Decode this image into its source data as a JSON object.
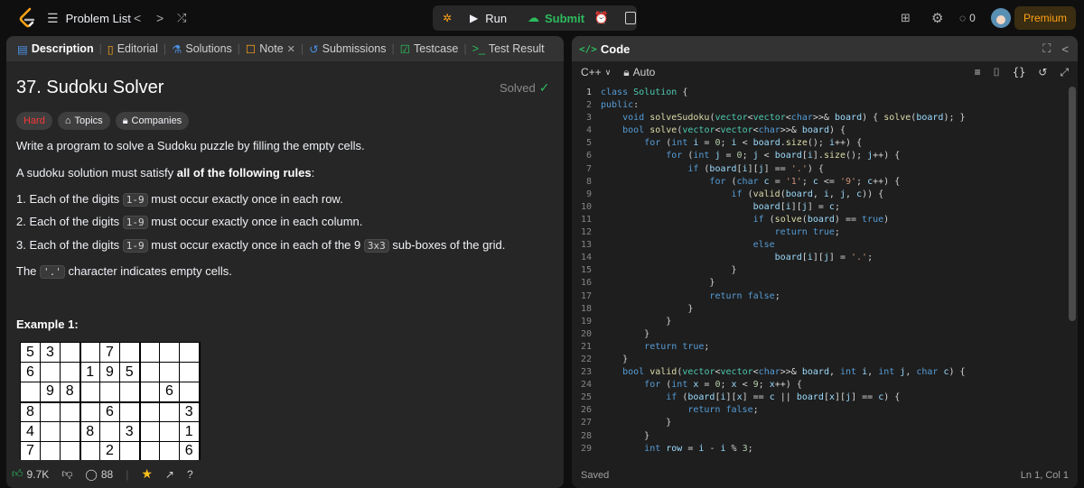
{
  "topbar": {
    "problem_list": "Problem List",
    "run": "Run",
    "submit": "Submit",
    "notif_count": "0",
    "premium": "Premium"
  },
  "tabs": {
    "description": "Description",
    "editorial": "Editorial",
    "solutions": "Solutions",
    "note": "Note",
    "submissions": "Submissions",
    "testcase": "Testcase",
    "test_result": "Test Result"
  },
  "problem": {
    "title": "37. Sudoku Solver",
    "status": "Solved",
    "difficulty": "Hard",
    "topics": "Topics",
    "companies": "Companies",
    "intro": "Write a program to solve a Sudoku puzzle by filling the empty cells.",
    "rules_lead": "A sudoku solution must satisfy ",
    "rules_bold": "all of the following rules",
    "rules_tail": ":",
    "rule1_a": "1. Each of the digits ",
    "rule1_code": "1-9",
    "rule1_b": " must occur exactly once in each row.",
    "rule2_a": "2. Each of the digits ",
    "rule2_code": "1-9",
    "rule2_b": " must occur exactly once in each column.",
    "rule3_a": "3. Each of the digits ",
    "rule3_code": "1-9",
    "rule3_b": " must occur exactly once in each of the 9 ",
    "rule3_code2": "3x3",
    "rule3_c": " sub-boxes of the grid.",
    "empty_a": "The ",
    "empty_code": "'.'",
    "empty_b": " character indicates empty cells.",
    "example_heading": "Example 1:"
  },
  "sudoku_rows": [
    [
      "5",
      "3",
      "",
      "",
      "7",
      "",
      "",
      "",
      ""
    ],
    [
      "6",
      "",
      "",
      "1",
      "9",
      "5",
      "",
      "",
      ""
    ],
    [
      "",
      "9",
      "8",
      "",
      "",
      "",
      "",
      "6",
      ""
    ],
    [
      "8",
      "",
      "",
      "",
      "6",
      "",
      "",
      "",
      "3"
    ],
    [
      "4",
      "",
      "",
      "8",
      "",
      "3",
      "",
      "",
      "1"
    ],
    [
      "7",
      "",
      "",
      "",
      "2",
      "",
      "",
      "",
      "6"
    ]
  ],
  "footer": {
    "likes": "9.7K",
    "comments": "88"
  },
  "editor": {
    "header": "Code",
    "language": "C++",
    "mode": "Auto",
    "status_left": "Saved",
    "status_right": "Ln 1, Col 1"
  },
  "code_lines": [
    "class Solution {",
    "public:",
    "    void solveSudoku(vector<vector<char>>& board) { solve(board); }",
    "    bool solve(vector<vector<char>>& board) {",
    "        for (int i = 0; i < board.size(); i++) {",
    "            for (int j = 0; j < board[i].size(); j++) {",
    "                if (board[i][j] == '.') {",
    "                    for (char c = '1'; c <= '9'; c++) {",
    "                        if (valid(board, i, j, c)) {",
    "                            board[i][j] = c;",
    "                            if (solve(board) == true)",
    "                                return true;",
    "                            else",
    "                                board[i][j] = '.';",
    "                        }",
    "                    }",
    "                    return false;",
    "                }",
    "            }",
    "        }",
    "        return true;",
    "    }",
    "    bool valid(vector<vector<char>>& board, int i, int j, char c) {",
    "        for (int x = 0; x < 9; x++) {",
    "            if (board[i][x] == c || board[x][j] == c) {",
    "                return false;",
    "            }",
    "        }",
    "        int row = i - i % 3;"
  ],
  "colors": {
    "accent_orange": "#ffa116",
    "submit_green": "#2cbb5d",
    "hard_red": "#f63737",
    "keyword_blue": "#569cd6"
  }
}
